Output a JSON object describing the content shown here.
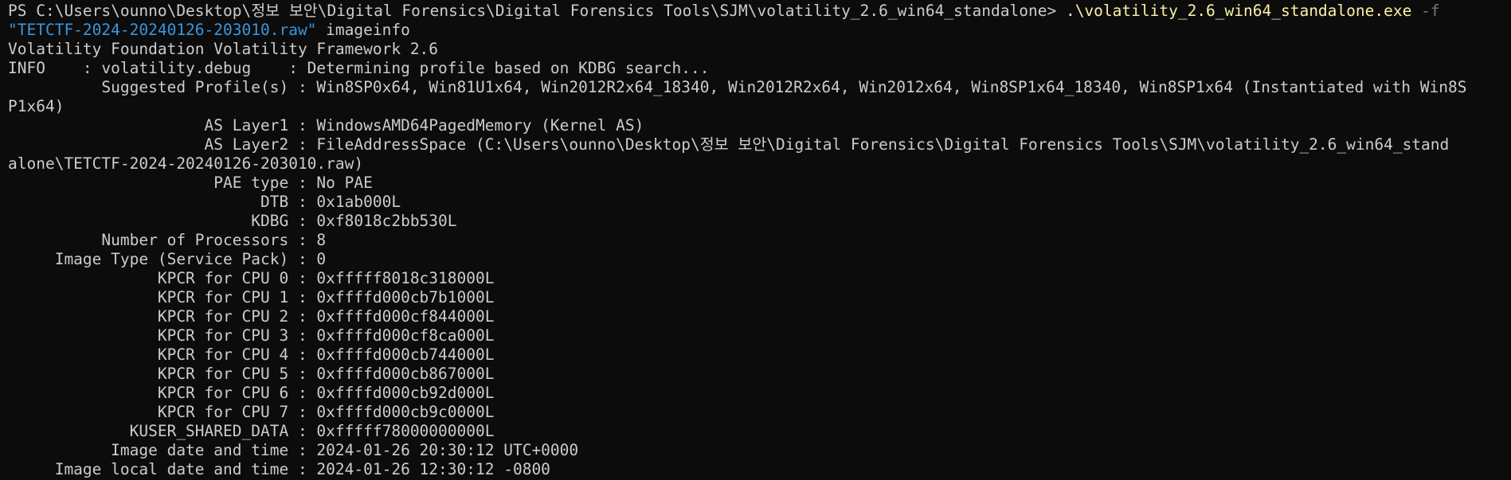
{
  "terminal": {
    "prompt": "PS C:\\Users\\ounno\\Desktop\\정보 보안\\Digital Forensics\\Digital Forensics Tools\\SJM\\volatility_2.6_win64_standalone> ",
    "exe": ".\\volatility_2.6_win64_standalone.exe",
    "flag": " -f",
    "file_arg": "\"TETCTF-2024-20240126-203010.raw\"",
    "command": " imageinfo",
    "output": [
      "Volatility Foundation Volatility Framework 2.6",
      "INFO    : volatility.debug    : Determining profile based on KDBG search...",
      "          Suggested Profile(s) : Win8SP0x64, Win81U1x64, Win2012R2x64_18340, Win2012R2x64, Win2012x64, Win8SP1x64_18340, Win8SP1x64 (Instantiated with Win8S",
      "P1x64)",
      "                     AS Layer1 : WindowsAMD64PagedMemory (Kernel AS)",
      "                     AS Layer2 : FileAddressSpace (C:\\Users\\ounno\\Desktop\\정보 보안\\Digital Forensics\\Digital Forensics Tools\\SJM\\volatility_2.6_win64_stand",
      "alone\\TETCTF-2024-20240126-203010.raw)",
      "                      PAE type : No PAE",
      "                           DTB : 0x1ab000L",
      "                          KDBG : 0xf8018c2bb530L",
      "          Number of Processors : 8",
      "     Image Type (Service Pack) : 0",
      "                KPCR for CPU 0 : 0xfffff8018c318000L",
      "                KPCR for CPU 1 : 0xffffd000cb7b1000L",
      "                KPCR for CPU 2 : 0xffffd000cf844000L",
      "                KPCR for CPU 3 : 0xffffd000cf8ca000L",
      "                KPCR for CPU 4 : 0xffffd000cb744000L",
      "                KPCR for CPU 5 : 0xffffd000cb867000L",
      "                KPCR for CPU 6 : 0xffffd000cb92d000L",
      "                KPCR for CPU 7 : 0xffffd000cb9c0000L",
      "             KUSER_SHARED_DATA : 0xfffff78000000000L",
      "           Image date and time : 2024-01-26 20:30:12 UTC+0000",
      "     Image local date and time : 2024-01-26 12:30:12 -0800"
    ]
  },
  "colors": {
    "background": "#0c0c0c",
    "foreground": "#cccccc",
    "executable": "#f9f1a5",
    "parameter": "#767676",
    "string": "#3a96dd"
  }
}
